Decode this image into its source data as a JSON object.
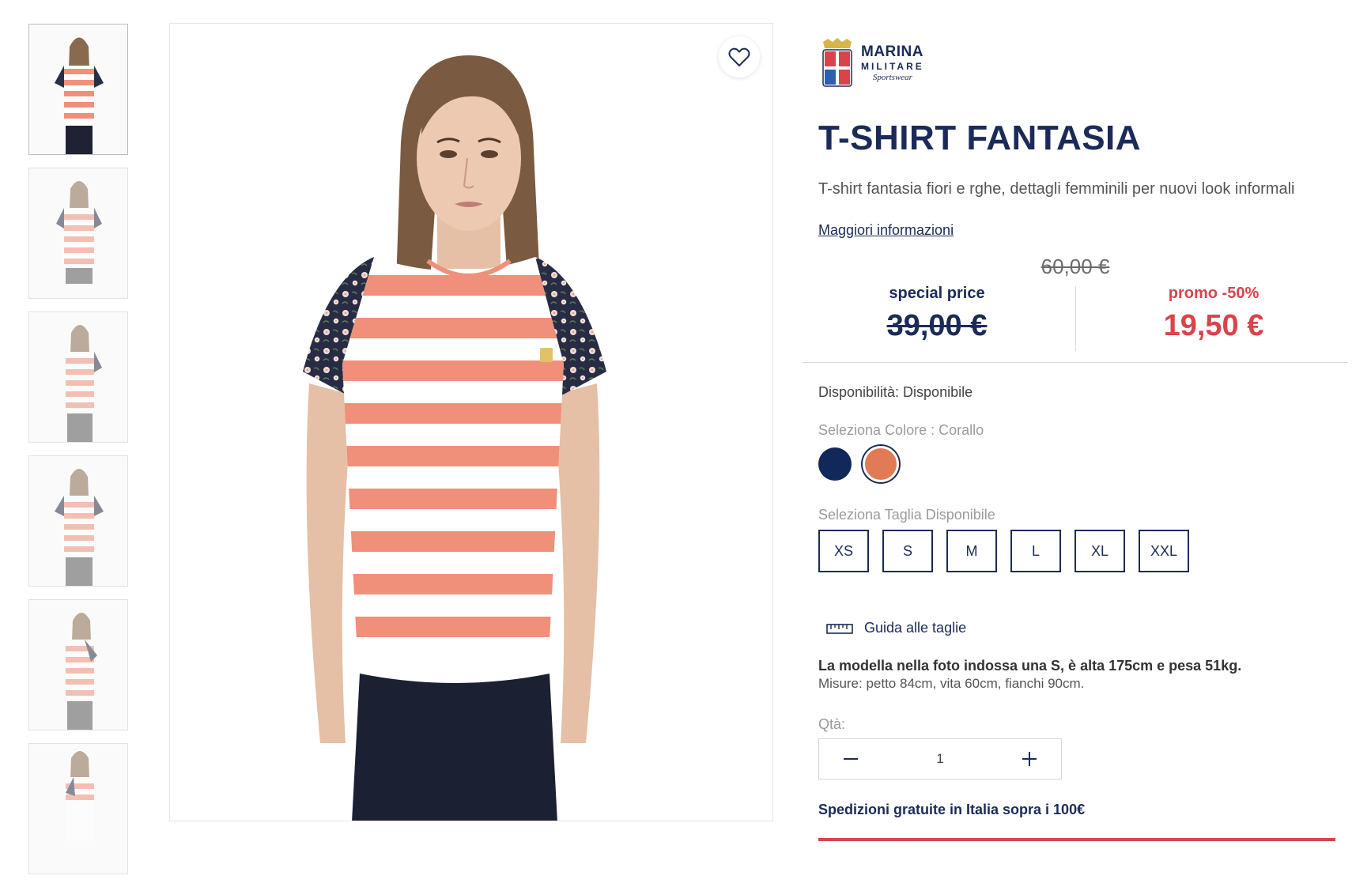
{
  "gallery": {
    "wishlist_icon": "heart-icon",
    "thumb_count": 6
  },
  "brand": {
    "line1": "MARINA",
    "line2": "MILITARE",
    "line3": "Sportswear"
  },
  "product": {
    "title": "T-SHIRT FANTASIA",
    "subtitle": "T-shirt fantasia fiori e rghe, dettagli femminili per nuovi look informali",
    "more_link": "Maggiori informazioni"
  },
  "pricing": {
    "original": "60,00 €",
    "special_label": "special price",
    "special_value": "39,00 €",
    "promo_label": "promo -50%",
    "promo_value": "19,50 €"
  },
  "availability": "Disponibilità: Disponibile",
  "color": {
    "label": "Seleziona Colore : Corallo",
    "options": [
      {
        "name": "Navy",
        "hex": "#12285a"
      },
      {
        "name": "Corallo",
        "hex": "#e17b55",
        "selected": true
      }
    ]
  },
  "size": {
    "label": "Seleziona Taglia Disponibile",
    "options": [
      "XS",
      "S",
      "M",
      "L",
      "XL",
      "XXL"
    ],
    "guide_label": "Guida alle taglie"
  },
  "model_info": {
    "line1": "La modella nella foto indossa una S, è alta 175cm e pesa 51kg.",
    "line2": "Misure: petto 84cm, vita 60cm, fianchi 90cm."
  },
  "quantity": {
    "label": "Qtà:",
    "value": "1"
  },
  "shipping": "Spedizioni gratuite in Italia sopra i 100€",
  "colors": {
    "navy": "#1b2b59",
    "red": "#d9434b",
    "coral": "#f0907a"
  }
}
